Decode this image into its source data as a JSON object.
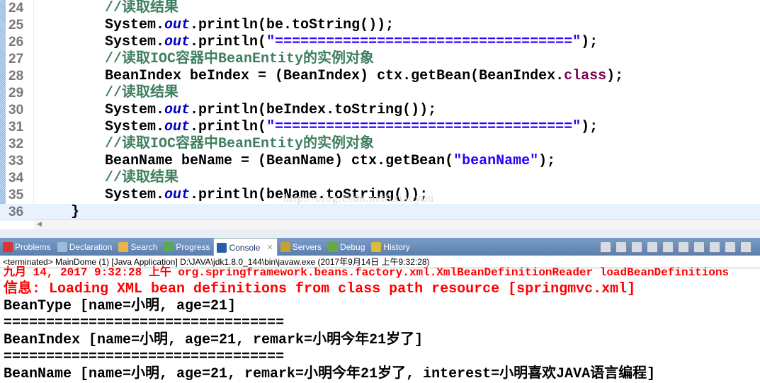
{
  "editor": {
    "lines": [
      {
        "n": "24",
        "parts": [
          {
            "t": "//读取结果",
            "c": "cm"
          }
        ]
      },
      {
        "n": "25",
        "parts": [
          {
            "t": "System.",
            "c": ""
          },
          {
            "t": "out",
            "c": "it"
          },
          {
            "t": ".println(be.toString());",
            "c": ""
          }
        ]
      },
      {
        "n": "26",
        "parts": [
          {
            "t": "System.",
            "c": ""
          },
          {
            "t": "out",
            "c": "it"
          },
          {
            "t": ".println(",
            "c": ""
          },
          {
            "t": "\"===================================\"",
            "c": "str"
          },
          {
            "t": ");",
            "c": ""
          }
        ]
      },
      {
        "n": "27",
        "parts": [
          {
            "t": "//读取IOC容器中BeanEntity的实例对象",
            "c": "cm"
          }
        ]
      },
      {
        "n": "28",
        "parts": [
          {
            "t": "BeanIndex beIndex = (BeanIndex) ctx.getBean(BeanIndex.",
            "c": ""
          },
          {
            "t": "class",
            "c": "kw"
          },
          {
            "t": ");",
            "c": ""
          }
        ]
      },
      {
        "n": "29",
        "parts": [
          {
            "t": "//读取结果",
            "c": "cm"
          }
        ]
      },
      {
        "n": "30",
        "parts": [
          {
            "t": "System.",
            "c": ""
          },
          {
            "t": "out",
            "c": "it"
          },
          {
            "t": ".println(beIndex.toString());",
            "c": ""
          }
        ]
      },
      {
        "n": "31",
        "parts": [
          {
            "t": "System.",
            "c": ""
          },
          {
            "t": "out",
            "c": "it"
          },
          {
            "t": ".println(",
            "c": ""
          },
          {
            "t": "\"===================================\"",
            "c": "str"
          },
          {
            "t": ");",
            "c": ""
          }
        ]
      },
      {
        "n": "32",
        "parts": [
          {
            "t": "//读取IOC容器中BeanEntity的实例对象",
            "c": "cm"
          }
        ]
      },
      {
        "n": "33",
        "parts": [
          {
            "t": "BeanName beName = (BeanName) ctx.getBean(",
            "c": ""
          },
          {
            "t": "\"beanName\"",
            "c": "str"
          },
          {
            "t": ");",
            "c": ""
          }
        ]
      },
      {
        "n": "34",
        "parts": [
          {
            "t": "//读取结果",
            "c": "cm"
          }
        ]
      },
      {
        "n": "35",
        "parts": [
          {
            "t": "System.",
            "c": ""
          },
          {
            "t": "out",
            "c": "it"
          },
          {
            "t": ".println(beName.toString());",
            "c": ""
          }
        ]
      },
      {
        "n": "36",
        "parts": [
          {
            "t": "}",
            "c": ""
          }
        ],
        "close": true
      }
    ],
    "watermark": "http://blog.csdn.net/ixiaoyou"
  },
  "tabs": [
    {
      "label": "Problems",
      "icon": "problems-icon",
      "color": "#d33"
    },
    {
      "label": "Declaration",
      "icon": "declaration-icon",
      "color": "#9bd"
    },
    {
      "label": "Search",
      "icon": "search-icon",
      "color": "#e9b44c"
    },
    {
      "label": "Progress",
      "icon": "progress-icon",
      "color": "#5a5"
    },
    {
      "label": "Console",
      "icon": "console-icon",
      "color": "#2a5caa",
      "active": true
    },
    {
      "label": "Servers",
      "icon": "servers-icon",
      "color": "#c8a030"
    },
    {
      "label": "Debug",
      "icon": "debug-icon",
      "color": "#6a4"
    },
    {
      "label": "History",
      "icon": "history-icon",
      "color": "#db3"
    }
  ],
  "console": {
    "status": "<terminated> MainDome (1) [Java Application] D:\\JAVA\\jdk1.8.0_144\\bin\\javaw.exe (2017年9月14日 上午9:32:28)",
    "output": [
      {
        "t": "九月 14, 2017 9:32:28 上午 org.springframework.beans.factory.xml.XmlBeanDefinitionReader loadBeanDefinitions",
        "red": true
      },
      {
        "t": "信息: Loading XML bean definitions from class path resource [springmvc.xml]",
        "red": true
      },
      {
        "t": "BeanType [name=小明, age=21]"
      },
      {
        "t": "================================="
      },
      {
        "t": "BeanIndex [name=小明, age=21, remark=小明今年21岁了]"
      },
      {
        "t": "================================="
      },
      {
        "t": "BeanName [name=小明, age=21, remark=小明今年21岁了, interest=小明喜欢JAVA语言编程]"
      }
    ]
  }
}
